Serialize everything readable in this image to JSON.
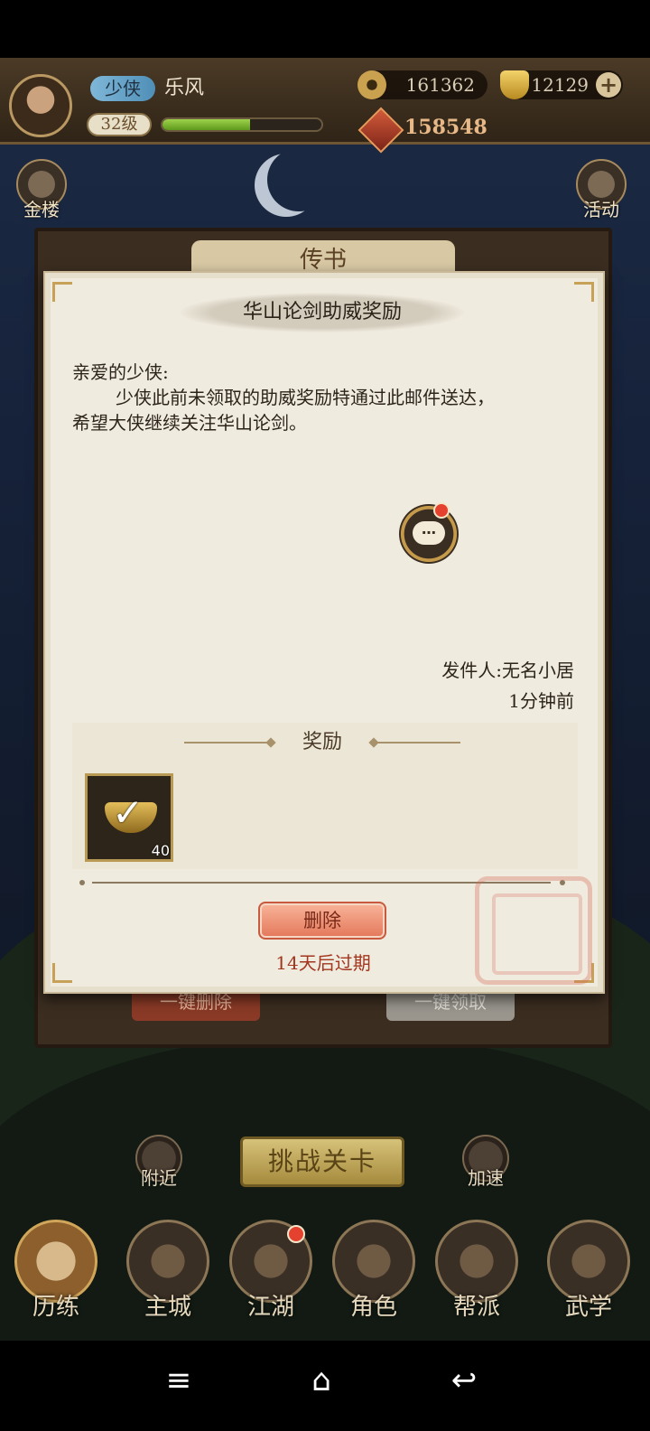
{
  "hud": {
    "title": "少侠",
    "name": "乐风",
    "level": "32级",
    "exp_fraction": 0.55,
    "coins": "161362",
    "gold": "12129",
    "power": "158548",
    "add_icon": "plus-icon"
  },
  "side_buttons": {
    "left_top": "金楼",
    "right_top": "活动"
  },
  "mail_panel": {
    "title": "传书",
    "delete_all": "一键删除",
    "claim_all": "一键领取"
  },
  "mail": {
    "title": "华山论剑助威奖励",
    "greeting": "亲爱的少侠:",
    "body_line1": "少侠此前未领取的助威奖励特通过此邮件送达，",
    "body_line2": "希望大侠继续关注华山论剑。",
    "sender": "发件人:无名小居",
    "time": "1分钟前",
    "reward_label": "奖励",
    "reward_item": {
      "icon": "gold-ingot-icon",
      "count": "40"
    },
    "delete_label": "删除",
    "expire_text": "14天后过期"
  },
  "bottom": {
    "nearby": "附近",
    "speed": "加速",
    "challenge": "挑战关卡"
  },
  "nav": [
    {
      "label": "历练"
    },
    {
      "label": "主城"
    },
    {
      "label": "江湖"
    },
    {
      "label": "角色"
    },
    {
      "label": "帮派"
    },
    {
      "label": "武学"
    }
  ],
  "system_nav": {
    "menu": "≡",
    "home": "⌂",
    "back": "↩"
  }
}
